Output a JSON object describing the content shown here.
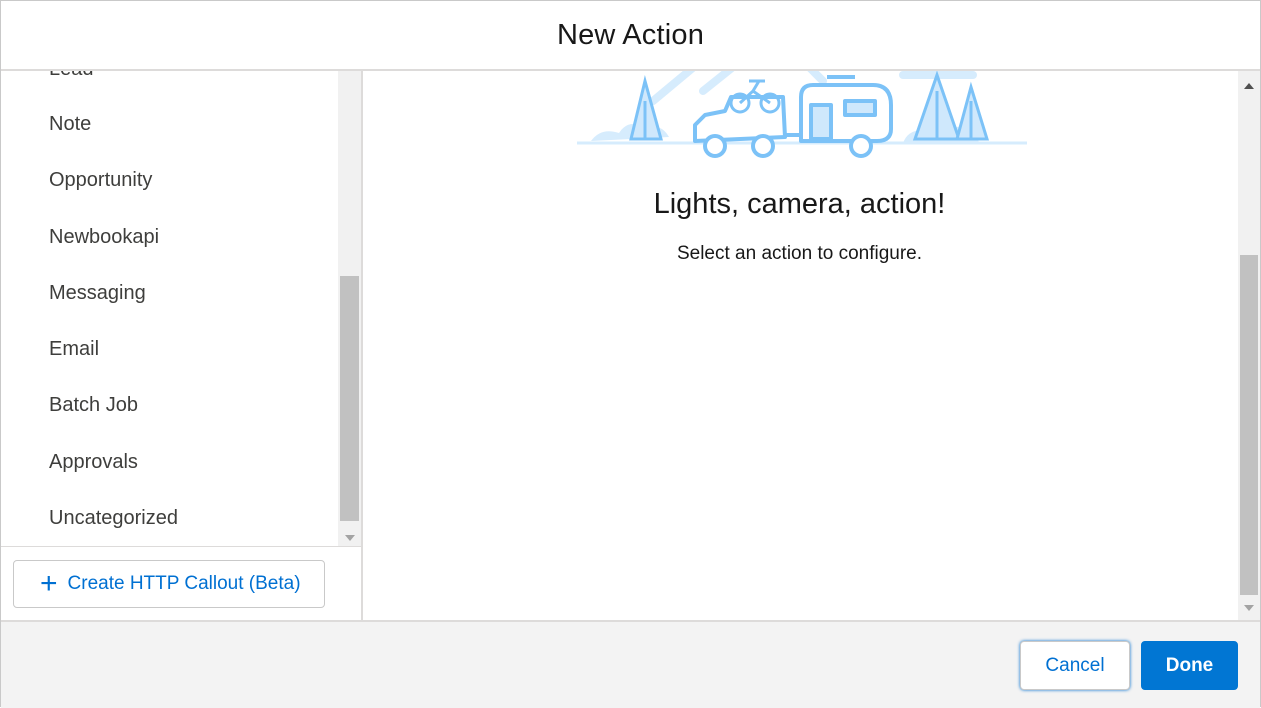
{
  "modal": {
    "title": "New Action"
  },
  "sidebar": {
    "items": [
      {
        "label": "Lead"
      },
      {
        "label": "Note"
      },
      {
        "label": "Opportunity"
      },
      {
        "label": "Newbookapi"
      },
      {
        "label": "Messaging"
      },
      {
        "label": "Email"
      },
      {
        "label": "Batch Job"
      },
      {
        "label": "Approvals"
      },
      {
        "label": "Uncategorized"
      }
    ],
    "create_button": {
      "icon": "plus-icon",
      "label": "Create HTTP Callout (Beta)"
    }
  },
  "main": {
    "illustration": "camping-trailer-illustration",
    "title": "Lights, camera, action!",
    "subtitle": "Select an action to configure."
  },
  "footer": {
    "cancel_label": "Cancel",
    "done_label": "Done"
  },
  "colors": {
    "accent": "#0176d3",
    "link": "#0070d2",
    "illustration": "#a8d8ff"
  }
}
